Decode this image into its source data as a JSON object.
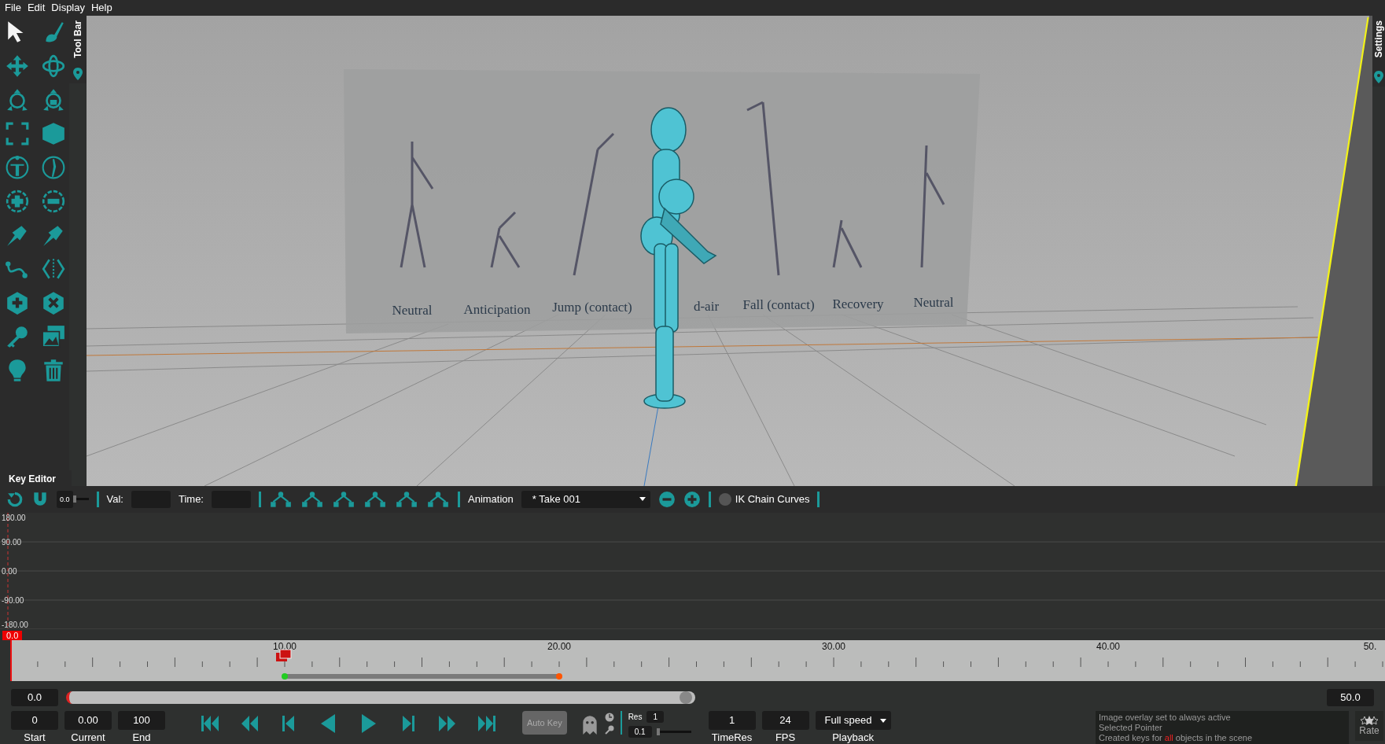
{
  "menu": [
    "File",
    "Edit",
    "Display",
    "Help"
  ],
  "toolbar": {
    "title": "Tool Bar",
    "tools": [
      {
        "selected": true
      },
      {
        "selected": false
      },
      {
        "selected": false
      },
      {
        "selected": false
      },
      {
        "selected": false
      },
      {
        "selected": false
      },
      {
        "selected": false
      },
      {
        "selected": false
      },
      {
        "selected": false
      },
      {
        "selected": false
      },
      {
        "selected": false
      },
      {
        "selected": false
      },
      {
        "selected": false
      },
      {
        "selected": false
      },
      {
        "selected": false
      },
      {
        "selected": false
      },
      {
        "selected": false
      },
      {
        "selected": false
      },
      {
        "selected": false
      },
      {
        "selected": false
      },
      {
        "selected": false
      },
      {
        "selected": false
      }
    ]
  },
  "settings_tab": {
    "title": "Settings"
  },
  "viewport": {
    "reference_labels": [
      "Neutral",
      "Anticipation",
      "Jump (contact)",
      "d-air",
      "Fall (contact)",
      "Recovery",
      "Neutral"
    ]
  },
  "key_editor": {
    "title": "Key Editor",
    "weight": "0.0",
    "weight_slider": {
      "level": 0
    },
    "val_label": "Val:",
    "time_label": "Time:",
    "animation_label": "Animation",
    "take": "* Take 001",
    "ik_chain_curves": {
      "label": "IK Chain Curves",
      "on": false
    },
    "y_labels": [
      "180.00",
      "90.00",
      "0.00",
      "-90.00",
      "-180.00"
    ]
  },
  "timeline": {
    "playhead": "0.0",
    "labels": [
      "10.00",
      "20.00",
      "30.00",
      "40.00",
      "50."
    ],
    "range_start": "0.0",
    "range_end": "50.0",
    "range": {
      "level": 0.5
    }
  },
  "controls": {
    "fields": [
      {
        "value": "0",
        "label": "Start"
      },
      {
        "value": "0.00",
        "label": "Current"
      },
      {
        "value": "100",
        "label": "End"
      }
    ],
    "auto_key": {
      "label": "Auto Key",
      "on": false
    },
    "res_label": "Res",
    "res": "1",
    "res_step": "0.1",
    "res_slider": {
      "level": 0
    },
    "time_res": {
      "value": "1",
      "label": "TimeRes"
    },
    "fps": {
      "value": "24",
      "label": "FPS"
    },
    "playback": {
      "value": "Full speed",
      "label": "Playback"
    }
  },
  "status_messages": [
    "Image overlay set to always active",
    "Selected Pointer",
    "Created keys for **all** objects in the scene"
  ],
  "rate_label": "Rate"
}
